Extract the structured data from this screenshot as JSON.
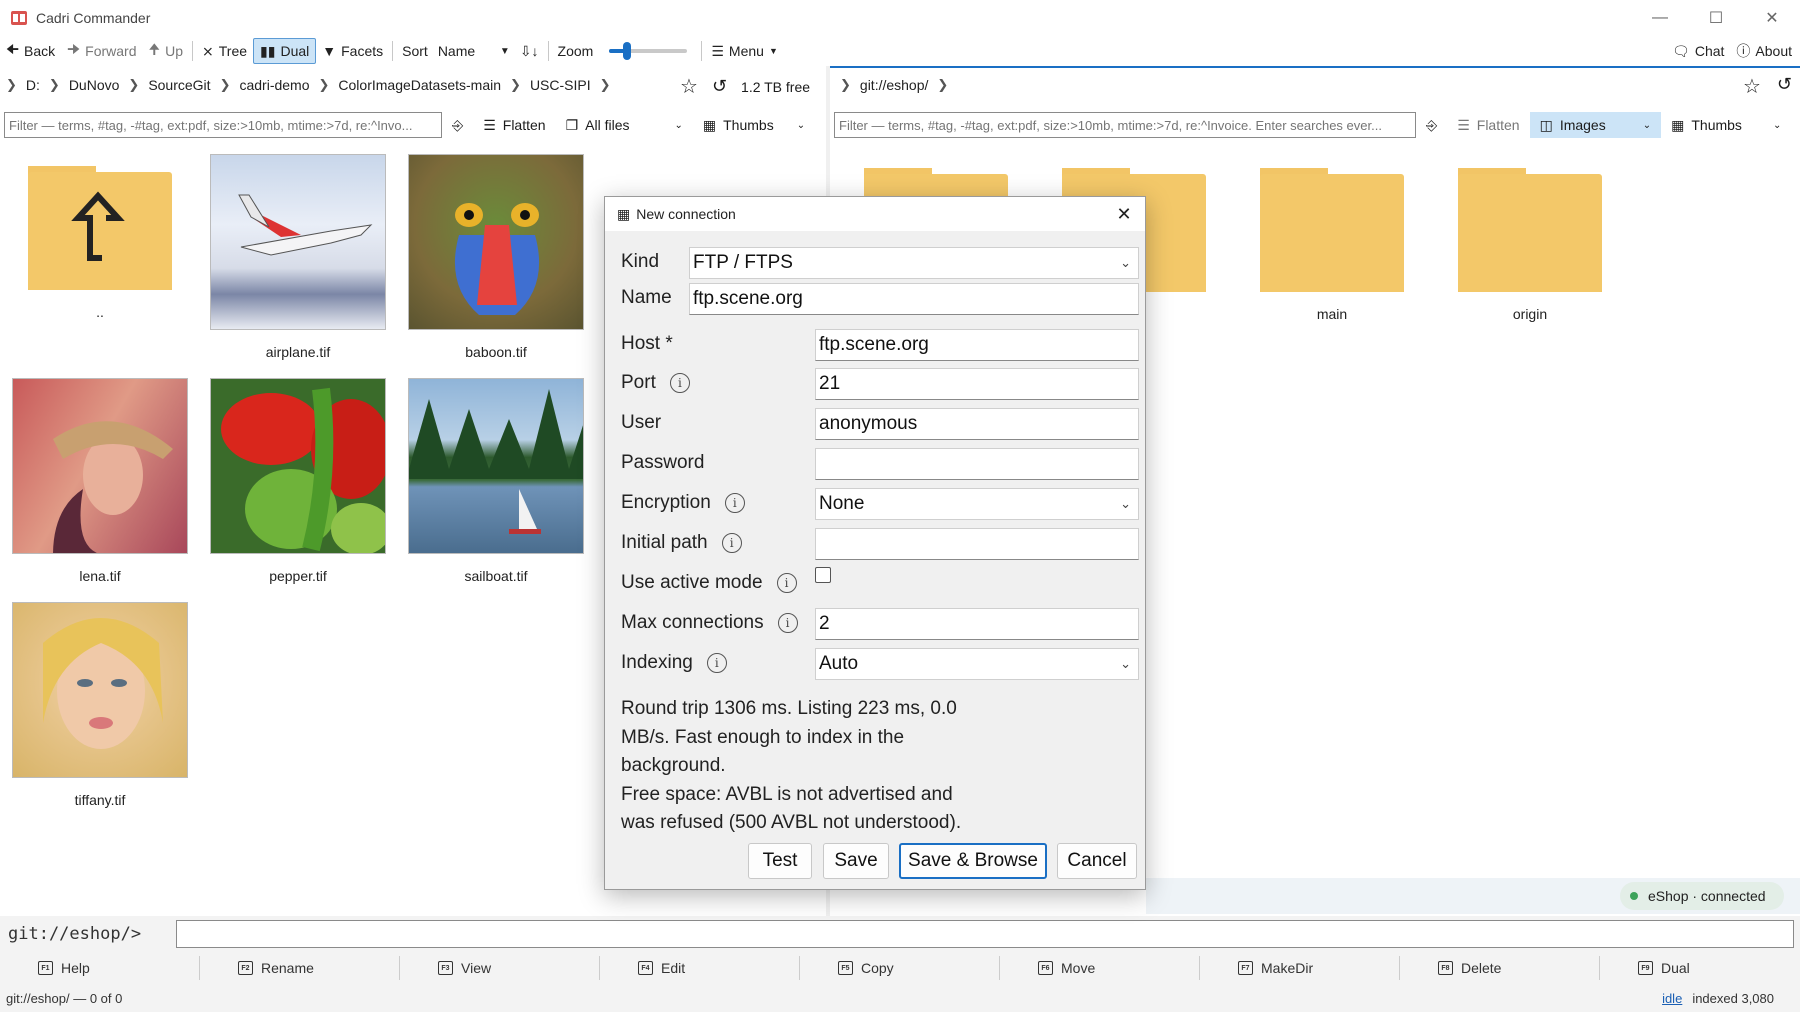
{
  "window": {
    "title": "Cadri Commander"
  },
  "toolbar": {
    "back": "Back",
    "forward": "Forward",
    "up": "Up",
    "tree": "Tree",
    "dual": "Dual",
    "facets": "Facets",
    "sort_label": "Sort",
    "sort_value": "Name",
    "zoom": "Zoom",
    "zoom_level": 0.22,
    "menu": "Menu",
    "chat": "Chat",
    "about": "About"
  },
  "left": {
    "breadcrumb": [
      "D:",
      "DuNovo",
      "SourceGit",
      "cadri-demo",
      "ColorImageDatasets-main",
      "USC-SIPI"
    ],
    "free_space": "1.2 TB free",
    "filter_placeholder": "Filter — terms, #tag, -#tag, ext:pdf, size:>10mb, mtime:>7d, re:^Invo...",
    "flatten": "Flatten",
    "files_mode": "All files",
    "view_mode": "Thumbs",
    "items": [
      {
        "name": ".."
      },
      {
        "name": "airplane.tif"
      },
      {
        "name": "baboon.tif"
      },
      {
        "name": ""
      },
      {
        "name": "lena.tif"
      },
      {
        "name": "pepper.tif"
      },
      {
        "name": "sailboat.tif"
      },
      {
        "name": "tiffany.tif"
      }
    ]
  },
  "right": {
    "breadcrumb": [
      "git://eshop/"
    ],
    "filter_placeholder": "Filter — terms, #tag, -#tag, ext:pdf, size:>10mb, mtime:>7d, re:^Invoice. Enter searches ever...",
    "flatten": "Flatten",
    "files_mode": "Images",
    "view_mode": "Thumbs",
    "items": [
      {
        "name": ""
      },
      {
        "name": ""
      },
      {
        "name": "main"
      },
      {
        "name": "origin"
      }
    ],
    "connection_status": "eShop · connected"
  },
  "dialog": {
    "title": "New connection",
    "kind_label": "Kind",
    "kind_value": "FTP / FTPS",
    "name_label": "Name",
    "name_value": "ftp.scene.org",
    "host_label": "Host *",
    "host_value": "ftp.scene.org",
    "port_label": "Port",
    "port_value": "21",
    "user_label": "User",
    "user_value": "anonymous",
    "password_label": "Password",
    "password_value": "",
    "encryption_label": "Encryption",
    "encryption_value": "None",
    "initial_path_label": "Initial path",
    "initial_path_value": "",
    "active_mode_label": "Use active mode",
    "active_mode_checked": false,
    "max_conn_label": "Max connections",
    "max_conn_value": "2",
    "indexing_label": "Indexing",
    "indexing_value": "Auto",
    "message": "Round trip 1306 ms. Listing 223 ms, 0.0 MB/s. Fast enough to index in the background.",
    "message2": "Free space: AVBL is not advertised and was refused (500 AVBL not understood).",
    "test": "Test",
    "save": "Save",
    "save_browse": "Save & Browse",
    "cancel": "Cancel"
  },
  "command": {
    "prompt": "git://eshop/>",
    "value": ""
  },
  "fkeys": [
    {
      "key": "F1",
      "label": "Help"
    },
    {
      "key": "F2",
      "label": "Rename"
    },
    {
      "key": "F3",
      "label": "View"
    },
    {
      "key": "F4",
      "label": "Edit"
    },
    {
      "key": "F5",
      "label": "Copy"
    },
    {
      "key": "F6",
      "label": "Move"
    },
    {
      "key": "F7",
      "label": "MakeDir"
    },
    {
      "key": "F8",
      "label": "Delete"
    },
    {
      "key": "F9",
      "label": "Dual"
    }
  ],
  "status": {
    "left": "git://eshop/ — 0 of 0",
    "idle": "idle",
    "indexed": "indexed 3,080"
  },
  "colors": {
    "accent": "#1a6fc4",
    "folder": "#f2c566",
    "selected": "#cce4f7",
    "connected": "#3da35a"
  }
}
